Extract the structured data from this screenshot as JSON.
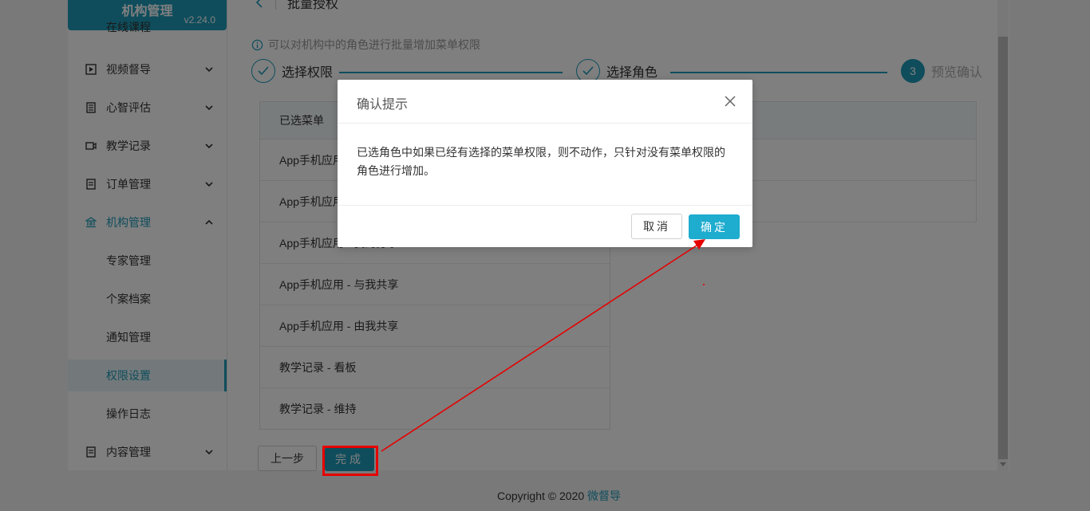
{
  "sidebar": {
    "brand_title": "机构管理",
    "version": "v2.24.0",
    "cut_item": "在线课程",
    "items": [
      {
        "label": "视频督导",
        "icon": "play-square-icon"
      },
      {
        "label": "心智评估",
        "icon": "list-doc-icon"
      },
      {
        "label": "教学记录",
        "icon": "video-camera-icon"
      },
      {
        "label": "订单管理",
        "icon": "receipt-icon"
      },
      {
        "label": "机构管理",
        "icon": "bank-icon"
      }
    ],
    "sub_items": [
      "专家管理",
      "个案档案",
      "通知管理",
      "权限设置",
      "操作日志"
    ],
    "last_item": {
      "label": "内容管理",
      "icon": "receipt-icon"
    }
  },
  "page": {
    "title": "批量授权",
    "tip": "可以对机构中的角色进行批量增加菜单权限"
  },
  "steps": [
    {
      "label": "选择权限",
      "state": "done"
    },
    {
      "label": "选择角色",
      "state": "done"
    },
    {
      "label": "预览确认",
      "number": "3",
      "state": "current"
    }
  ],
  "table": {
    "header": "已选菜单",
    "rows": [
      "App手机应用 - 我的资料",
      "App手机应用 - 我的收藏",
      "App手机应用 - 我的分享",
      "App手机应用 - 与我共享",
      "App手机应用 - 由我共享",
      "教学记录 - 看板",
      "教学记录 - 维持"
    ]
  },
  "buttons": {
    "prev": "上一步",
    "done": "完成"
  },
  "footer": {
    "text": "Copyright © 2020 ",
    "brand": "微督导"
  },
  "dialog": {
    "title": "确认提示",
    "body": "已选角色中如果已经有选择的菜单权限，则不动作，只针对没有菜单权限的角色进行增加。",
    "cancel": "取消",
    "ok": "确定"
  },
  "colors": {
    "accent": "#1e9bb8",
    "annotation": "#e60000"
  }
}
